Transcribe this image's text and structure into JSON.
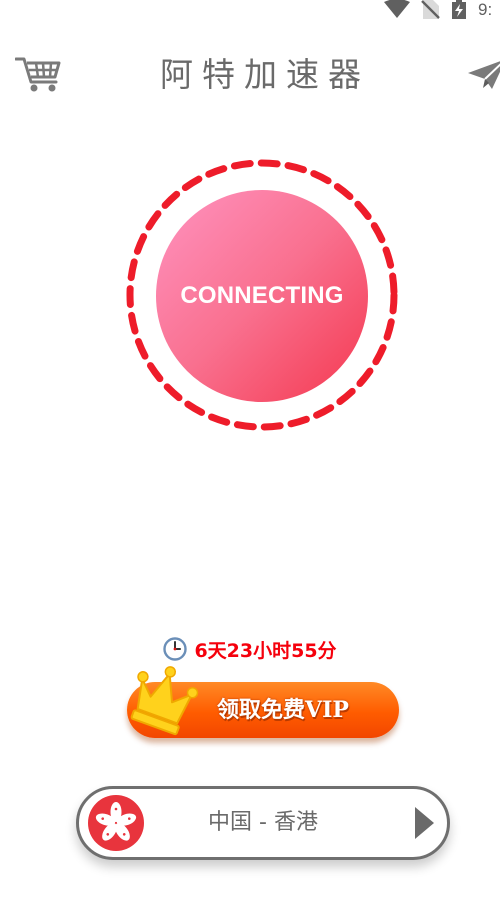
{
  "status_bar": {
    "time": "9:",
    "icons": [
      "wifi-icon",
      "no-sim-icon",
      "battery-charging-icon"
    ]
  },
  "header": {
    "title": "阿特加速器",
    "left_icon": "shopping-cart-icon",
    "right_icon": "paper-plane-share-icon"
  },
  "connect": {
    "label": "CONNECTING",
    "ring_icon": "dashed-progress-ring"
  },
  "timer": {
    "icon": "clock-icon",
    "text": "6天23小时55分"
  },
  "vip": {
    "label": "领取免费VIP",
    "icon": "crown-icon"
  },
  "server": {
    "flag_icon": "hong-kong-flag-icon",
    "name": "中国 - 香港",
    "arrow_icon": "right-arrow-icon"
  },
  "colors": {
    "accent_red": "#f5000c",
    "ring_red": "#ee1c2a",
    "button_pink_light": "#ff93c0",
    "button_pink_dark": "#f4384f",
    "vip_orange": "#ff5c00",
    "crown_gold": "#ffd21c",
    "text_gray": "#6a6a6a"
  }
}
